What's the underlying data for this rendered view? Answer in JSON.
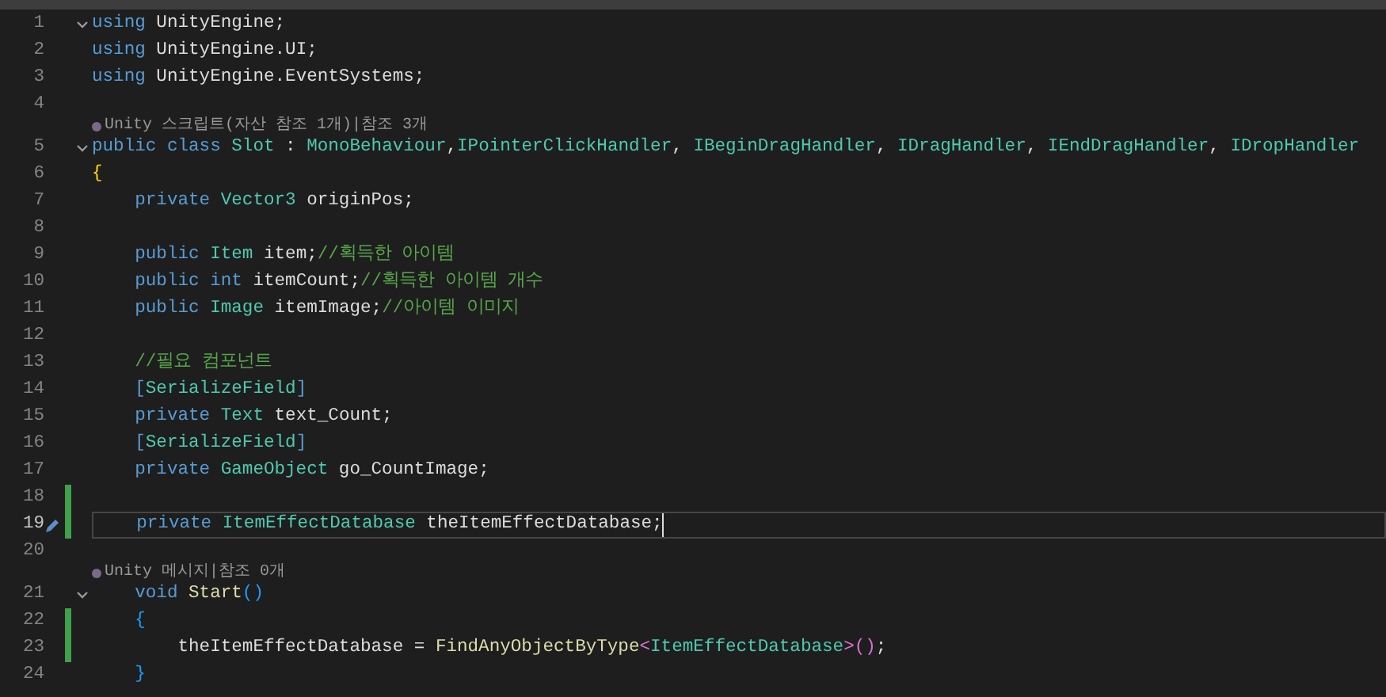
{
  "lines": [
    {
      "number": "1",
      "foldable": true,
      "modified": false,
      "current": false,
      "tokens": [
        {
          "t": "using",
          "kind": "kw"
        },
        {
          "t": " UnityEngine;",
          "kind": "ident"
        }
      ]
    },
    {
      "number": "2",
      "foldable": false,
      "modified": false,
      "current": false,
      "tokens": [
        {
          "t": "using",
          "kind": "kw"
        },
        {
          "t": " UnityEngine.UI;",
          "kind": "ident"
        }
      ]
    },
    {
      "number": "3",
      "foldable": false,
      "modified": false,
      "current": false,
      "tokens": [
        {
          "t": "using",
          "kind": "kw"
        },
        {
          "t": " UnityEngine.EventSystems;",
          "kind": "ident"
        }
      ]
    },
    {
      "number": "4",
      "foldable": false,
      "modified": false,
      "current": false
    },
    {
      "number": "5",
      "foldable": true,
      "modified": false,
      "current": false,
      "codelens": "Unity 스크립트(자산 참조 1개)|참조 3개",
      "tokens": [
        {
          "t": "public class",
          "kind": "kw"
        },
        {
          "t": " Slot",
          "kind": "type"
        },
        {
          "t": " : ",
          "kind": "ident"
        },
        {
          "t": "MonoBehaviour",
          "kind": "type"
        },
        {
          "t": ",",
          "kind": "ident"
        },
        {
          "t": "IPointerClickHandler",
          "kind": "type"
        },
        {
          "t": ", ",
          "kind": "ident"
        },
        {
          "t": "IBeginDragHandler",
          "kind": "type"
        },
        {
          "t": ", ",
          "kind": "ident"
        },
        {
          "t": "IDragHandler",
          "kind": "type"
        },
        {
          "t": ", ",
          "kind": "ident"
        },
        {
          "t": "IEndDragHandler",
          "kind": "type"
        },
        {
          "t": ", ",
          "kind": "ident"
        },
        {
          "t": "IDropHandler",
          "kind": "type"
        }
      ]
    },
    {
      "number": "6",
      "foldable": false,
      "modified": false,
      "current": false,
      "tokens": [
        {
          "t": "{",
          "kind": "brace1"
        }
      ]
    },
    {
      "number": "7",
      "foldable": false,
      "modified": false,
      "current": false,
      "tokens": [
        {
          "t": "    private",
          "kind": "kw"
        },
        {
          "t": " Vector3",
          "kind": "type"
        },
        {
          "t": " originPos;",
          "kind": "ident"
        }
      ]
    },
    {
      "number": "8",
      "foldable": false,
      "modified": false,
      "current": false
    },
    {
      "number": "9",
      "foldable": false,
      "modified": false,
      "current": false,
      "tokens": [
        {
          "t": "    public",
          "kind": "kw"
        },
        {
          "t": " Item",
          "kind": "type"
        },
        {
          "t": " item;",
          "kind": "ident"
        },
        {
          "t": "//획득한 아이템",
          "kind": "comment"
        }
      ]
    },
    {
      "number": "10",
      "foldable": false,
      "modified": false,
      "current": false,
      "tokens": [
        {
          "t": "    public int",
          "kind": "kw"
        },
        {
          "t": " itemCount;",
          "kind": "ident"
        },
        {
          "t": "//획득한 아이템 개수",
          "kind": "comment"
        }
      ]
    },
    {
      "number": "11",
      "foldable": false,
      "modified": false,
      "current": false,
      "tokens": [
        {
          "t": "    public",
          "kind": "kw"
        },
        {
          "t": " Image",
          "kind": "type"
        },
        {
          "t": " itemImage;",
          "kind": "ident"
        },
        {
          "t": "//아이템 이미지",
          "kind": "comment"
        }
      ]
    },
    {
      "number": "12",
      "foldable": false,
      "modified": false,
      "current": false
    },
    {
      "number": "13",
      "foldable": false,
      "modified": false,
      "current": false,
      "tokens": [
        {
          "t": "    //필요 컴포넌트",
          "kind": "comment"
        }
      ]
    },
    {
      "number": "14",
      "foldable": false,
      "modified": false,
      "current": false,
      "tokens": [
        {
          "t": "    [",
          "kind": "kw"
        },
        {
          "t": "SerializeField",
          "kind": "attr"
        },
        {
          "t": "]",
          "kind": "kw"
        }
      ]
    },
    {
      "number": "15",
      "foldable": false,
      "modified": false,
      "current": false,
      "tokens": [
        {
          "t": "    private",
          "kind": "kw"
        },
        {
          "t": " Text",
          "kind": "type"
        },
        {
          "t": " text_Count;",
          "kind": "ident"
        }
      ]
    },
    {
      "number": "16",
      "foldable": false,
      "modified": false,
      "current": false,
      "tokens": [
        {
          "t": "    [",
          "kind": "kw"
        },
        {
          "t": "SerializeField",
          "kind": "attr"
        },
        {
          "t": "]",
          "kind": "kw"
        }
      ]
    },
    {
      "number": "17",
      "foldable": false,
      "modified": false,
      "current": false,
      "tokens": [
        {
          "t": "    private",
          "kind": "kw"
        },
        {
          "t": " GameObject",
          "kind": "type"
        },
        {
          "t": " go_CountImage;",
          "kind": "ident"
        }
      ]
    },
    {
      "number": "18",
      "foldable": false,
      "modified": true,
      "current": false
    },
    {
      "number": "19",
      "foldable": false,
      "modified": true,
      "current": true,
      "tokens": [
        {
          "t": "    private",
          "kind": "kw"
        },
        {
          "t": " ItemEffectDatabase",
          "kind": "type"
        },
        {
          "t": " theItemEffectDatabase;",
          "kind": "ident"
        }
      ]
    },
    {
      "number": "20",
      "foldable": false,
      "modified": false,
      "current": false
    },
    {
      "number": "21",
      "foldable": true,
      "modified": false,
      "current": false,
      "codelens": "Unity 메시지|참조 0개",
      "tokens": [
        {
          "t": "    void",
          "kind": "kw"
        },
        {
          "t": " Start",
          "kind": "method"
        },
        {
          "t": "()",
          "kind": "brace2"
        }
      ]
    },
    {
      "number": "22",
      "foldable": false,
      "modified": true,
      "current": false,
      "tokens": [
        {
          "t": "    {",
          "kind": "brace2"
        }
      ]
    },
    {
      "number": "23",
      "foldable": false,
      "modified": true,
      "current": false,
      "tokens": [
        {
          "t": "        theItemEffectDatabase = ",
          "kind": "ident"
        },
        {
          "t": "FindAnyObjectByType",
          "kind": "method"
        },
        {
          "t": "<",
          "kind": "brace3"
        },
        {
          "t": "ItemEffectDatabase",
          "kind": "type"
        },
        {
          "t": ">()",
          "kind": "brace3"
        },
        {
          "t": ";",
          "kind": "ident"
        }
      ]
    },
    {
      "number": "24",
      "foldable": false,
      "modified": false,
      "current": false,
      "tokens": [
        {
          "t": "    }",
          "kind": "brace2"
        }
      ]
    }
  ]
}
